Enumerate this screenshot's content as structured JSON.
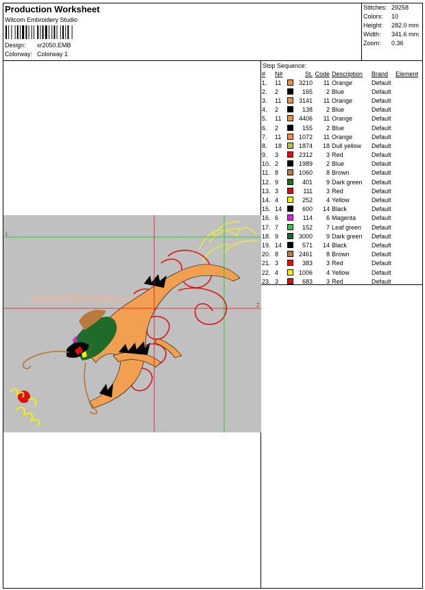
{
  "header": {
    "title": "Production Worksheet",
    "software": "Wilcom  Embroidery Studio",
    "design_label": "Design:",
    "design_value": "xr2050.EMB",
    "colorway_label": "Colorway:",
    "colorway_value": "Colorway 1"
  },
  "stats": [
    {
      "label": "Stitches:",
      "value": "29258"
    },
    {
      "label": "Colors:",
      "value": "10"
    },
    {
      "label": "Height:",
      "value": "282.0 mm"
    },
    {
      "label": "Width:",
      "value": "341.6 mm"
    },
    {
      "label": "Zoom:",
      "value": "0.36"
    }
  ],
  "stop_sequence": {
    "title": "Stop Sequence:",
    "headers": [
      "#",
      "N#",
      "St.",
      "Code",
      "Description",
      "Brand",
      "Element"
    ],
    "rows": [
      {
        "idx": "1.",
        "n": "11",
        "color": "#f0913b",
        "st": "3210",
        "code": "11",
        "desc": "Orange",
        "brand": "Default"
      },
      {
        "idx": "2.",
        "n": "2",
        "color": "#000000",
        "st": "165",
        "code": "2",
        "desc": "Blue",
        "brand": "Default"
      },
      {
        "idx": "3.",
        "n": "11",
        "color": "#f0913b",
        "st": "3141",
        "code": "11",
        "desc": "Orange",
        "brand": "Default"
      },
      {
        "idx": "4.",
        "n": "2",
        "color": "#000000",
        "st": "138",
        "code": "2",
        "desc": "Blue",
        "brand": "Default"
      },
      {
        "idx": "5.",
        "n": "11",
        "color": "#f0913b",
        "st": "4406",
        "code": "11",
        "desc": "Orange",
        "brand": "Default"
      },
      {
        "idx": "6.",
        "n": "2",
        "color": "#000000",
        "st": "155",
        "code": "2",
        "desc": "Blue",
        "brand": "Default"
      },
      {
        "idx": "7.",
        "n": "11",
        "color": "#f0913b",
        "st": "1072",
        "code": "11",
        "desc": "Orange",
        "brand": "Default"
      },
      {
        "idx": "8.",
        "n": "18",
        "color": "#c5c23a",
        "st": "1874",
        "code": "18",
        "desc": "Dull yellow",
        "brand": "Default"
      },
      {
        "idx": "9.",
        "n": "3",
        "color": "#e01010",
        "st": "2312",
        "code": "3",
        "desc": "Red",
        "brand": "Default"
      },
      {
        "idx": "10.",
        "n": "2",
        "color": "#000000",
        "st": "1989",
        "code": "2",
        "desc": "Blue",
        "brand": "Default"
      },
      {
        "idx": "11.",
        "n": "8",
        "color": "#b97a3e",
        "st": "1060",
        "code": "8",
        "desc": "Brown",
        "brand": "Default"
      },
      {
        "idx": "12.",
        "n": "9",
        "color": "#1e6b2a",
        "st": "401",
        "code": "9",
        "desc": "Dark green",
        "brand": "Default"
      },
      {
        "idx": "13.",
        "n": "3",
        "color": "#e01010",
        "st": "111",
        "code": "3",
        "desc": "Red",
        "brand": "Default"
      },
      {
        "idx": "14.",
        "n": "4",
        "color": "#f5f000",
        "st": "252",
        "code": "4",
        "desc": "Yellow",
        "brand": "Default"
      },
      {
        "idx": "15.",
        "n": "14",
        "color": "#000000",
        "st": "600",
        "code": "14",
        "desc": "Black",
        "brand": "Default"
      },
      {
        "idx": "16.",
        "n": "6",
        "color": "#e020e0",
        "st": "114",
        "code": "6",
        "desc": "Magenta",
        "brand": "Default"
      },
      {
        "idx": "17.",
        "n": "7",
        "color": "#3cba4a",
        "st": "152",
        "code": "7",
        "desc": "Leaf green",
        "brand": "Default"
      },
      {
        "idx": "18.",
        "n": "9",
        "color": "#1e6b2a",
        "st": "3000",
        "code": "9",
        "desc": "Dark green",
        "brand": "Default"
      },
      {
        "idx": "19.",
        "n": "14",
        "color": "#000000",
        "st": "571",
        "code": "14",
        "desc": "Black",
        "brand": "Default"
      },
      {
        "idx": "20.",
        "n": "8",
        "color": "#b97a3e",
        "st": "2461",
        "code": "8",
        "desc": "Brown",
        "brand": "Default"
      },
      {
        "idx": "21.",
        "n": "3",
        "color": "#e01010",
        "st": "383",
        "code": "3",
        "desc": "Red",
        "brand": "Default"
      },
      {
        "idx": "22.",
        "n": "4",
        "color": "#f5f000",
        "st": "1006",
        "code": "4",
        "desc": "Yellow",
        "brand": "Default"
      },
      {
        "idx": "23.",
        "n": "3",
        "color": "#e01010",
        "st": "683",
        "code": "3",
        "desc": "Red",
        "brand": "Default"
      }
    ]
  },
  "canvas": {
    "background": "#c0c0c0",
    "guide_red_label": "2",
    "guide_green_label": "1",
    "watermark": "topembroidery.com"
  }
}
